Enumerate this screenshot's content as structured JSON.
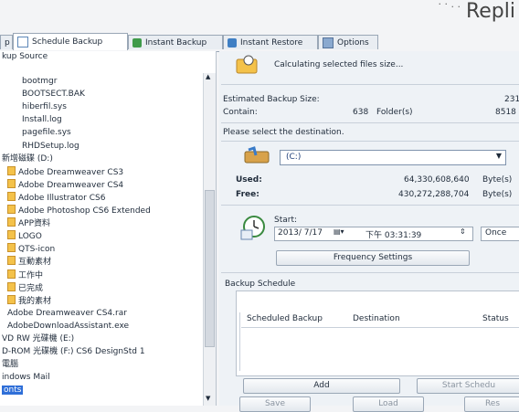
{
  "app_title": "Repli",
  "title_dots": "·  · . .",
  "tabs": [
    {
      "label": "p"
    },
    {
      "label": "Schedule Backup"
    },
    {
      "label": "Instant Backup"
    },
    {
      "label": "Instant Restore"
    },
    {
      "label": "Options"
    }
  ],
  "source_header": "kup Source",
  "tree": [
    "bootmgr",
    "BOOTSECT.BAK",
    "hiberfil.sys",
    "Install.log",
    "pagefile.sys",
    "RHDSetup.log",
    "新增磁碟 (D:)",
    "Adobe Dreamweaver CS3",
    "Adobe Dreamweaver CS4",
    "Adobe Illustrator CS6",
    "Adobe Photoshop CS6 Extended",
    "APP資料",
    "LOGO",
    "QTS-icon",
    "互動素材",
    "工作中",
    "已完成",
    "我的素材",
    "Adobe Dreamweaver CS4.rar",
    "AdobeDownloadAssistant.exe",
    "VD RW 光碟機 (E:)",
    "D-ROM 光碟機 (F:) CS6 DesignStd 1",
    "電腦",
    "indows Mail",
    "onts"
  ],
  "calc_text": "Calculating selected files size...",
  "estimated_label": "Estimated Backup Size:",
  "estimated_value": "231",
  "contain_label": "Contain:",
  "contain_count": "638",
  "folder_label": "Folder(s)",
  "folder_count": "8518",
  "dest_prompt": "Please select the destination.",
  "dest_value": "(C:)",
  "used_label": "Used:",
  "used_value": "64,330,608,640",
  "used_unit": "Byte(s)",
  "free_label": "Free:",
  "free_value": "430,272,288,704",
  "free_unit": "Byte(s)",
  "start_label": "Start:",
  "start_date": "2013/ 7/17",
  "start_time": "下午 03:31:39",
  "start_repeat": "Once",
  "freq_button": "Frequency Settings",
  "schedule_title": "Backup Schedule",
  "columns": [
    "Scheduled Backup",
    "Destination",
    "Status"
  ],
  "add_button": "Add",
  "start_schedule_button": "Start Schedu",
  "bottom_buttons": [
    "Save",
    "Load",
    "Res"
  ]
}
